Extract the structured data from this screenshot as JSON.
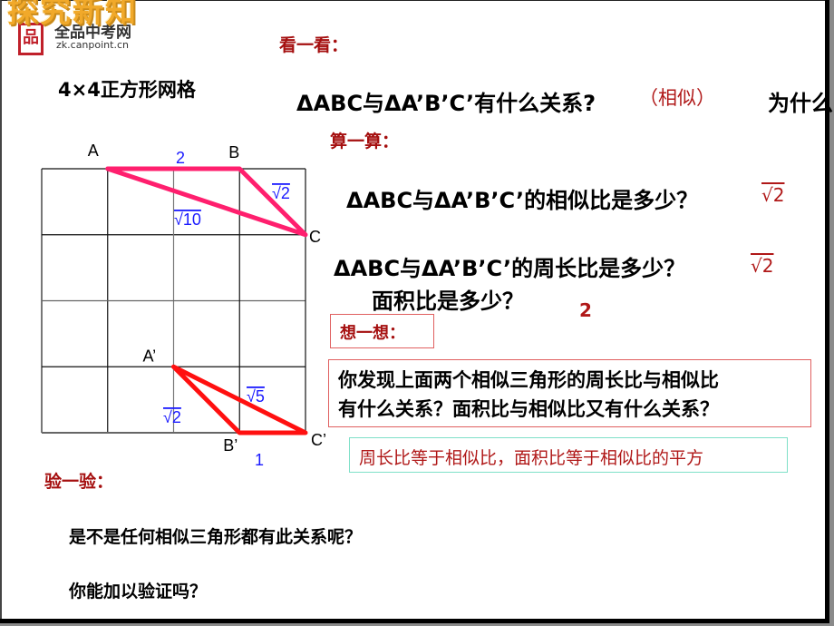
{
  "header": {
    "title": "探究新知",
    "logo_name": "全品中考网",
    "logo_url_text": "zk.canpoint.cn",
    "logo_seal": "品"
  },
  "grid_label": "4×4正方形网格",
  "sections": {
    "look": "看一看：",
    "calc": "算一算：",
    "think": "想一想：",
    "verify": "验一验："
  },
  "questions": {
    "relation": "ΔABC与ΔA’B’C’有什么关系?",
    "relation_answer": "（相似）",
    "why": "为什么",
    "similarity_ratio": "ΔABC与ΔA’B’C’的相似比是多少？",
    "similarity_answer": "√2",
    "perimeter_ratio": "ΔABC与ΔA’B’C’的周长比是多少？",
    "perimeter_answer": "√2",
    "area_ratio": "面积比是多少？",
    "area_answer": "2",
    "discover": [
      "你发现上面两个相似三角形的周长比与相似比",
      "有什么关系？面积比与相似比又有什么关系？"
    ],
    "conclusion": "周长比等于相似比，面积比等于相似比的平方",
    "verify_q1": "是不是任何相似三角形都有此关系呢？",
    "verify_q2": "你能加以验证吗？"
  },
  "figure": {
    "grid_size": 4,
    "triangle1": {
      "color": "#ff1f6e",
      "vertices": [
        {
          "label": "A",
          "col": 1,
          "row": 0
        },
        {
          "label": "B",
          "col": 3,
          "row": 0
        },
        {
          "label": "C",
          "col": 4,
          "row": 1
        }
      ],
      "side_labels": {
        "AB": "2",
        "BC": "√2",
        "AC": "√10"
      }
    },
    "triangle2": {
      "color": "#ff1010",
      "vertices": [
        {
          "label": "A’",
          "col": 2,
          "row": 3
        },
        {
          "label": "B’",
          "col": 3,
          "row": 4
        },
        {
          "label": "C’",
          "col": 4,
          "row": 4
        }
      ],
      "side_labels": {
        "A'B'": "√2",
        "A'C'": "√5",
        "B'C'": "1"
      }
    }
  },
  "colors": {
    "section_title": "#a50f0f",
    "answer_red": "#b01818",
    "side_label_blue": "#1a1aff",
    "box_red_border": "#e06060",
    "box_green_border": "#7fe0c8"
  }
}
